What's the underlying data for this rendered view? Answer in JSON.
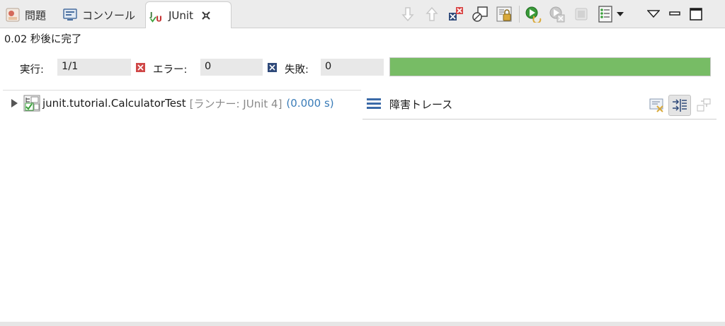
{
  "tabs": {
    "problems": "問題",
    "console": "コンソール",
    "junit": "JUnit"
  },
  "status": {
    "finished_text": "0.02 秒後に完了"
  },
  "counters": {
    "runs_label": "実行:",
    "runs_value": "1/1",
    "errors_label": "エラー:",
    "errors_value": "0",
    "failures_label": "失敗:",
    "failures_value": "0"
  },
  "progress": {
    "fraction": 1.0,
    "color": "#77bc65"
  },
  "tree": {
    "item_name": "junit.tutorial.CalculatorTest",
    "item_runner": "[ランナー: JUnit 4]",
    "item_time": "(0.000 s)"
  },
  "trace": {
    "title": "障害トレース"
  },
  "icons": {
    "toolbar": [
      "next-failure-icon",
      "previous-failure-icon",
      "show-failures-only-icon",
      "show-skipped-icon",
      "scroll-lock-icon",
      "rerun-icon",
      "rerun-failed-first-icon",
      "stop-icon",
      "history-icon",
      "view-menu-icon",
      "minimize-icon",
      "maximize-icon"
    ],
    "trace": [
      "filter-stack-icon",
      "compare-results-icon",
      "copy-trace-icon"
    ]
  }
}
